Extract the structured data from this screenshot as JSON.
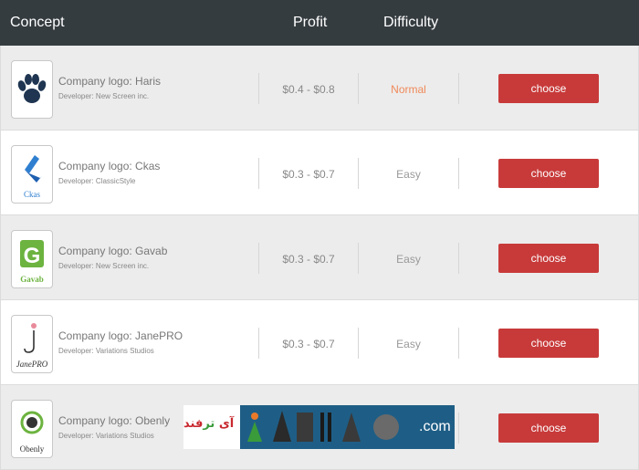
{
  "header": {
    "concept": "Concept",
    "profit": "Profit",
    "difficulty": "Difficulty"
  },
  "rows": [
    {
      "logo_icon": "paw-icon",
      "logo_text": "",
      "title": "Company logo: Haris",
      "developer": "Developer: New Screen inc.",
      "profit": "$0.4 - $0.8",
      "difficulty": "Normal",
      "difficulty_color": "#f08a5a",
      "button": "choose"
    },
    {
      "logo_icon": "chevron-logo-icon",
      "logo_text": "Ckas",
      "title": "Company logo: Ckas",
      "developer": "Developer: ClassicStyle",
      "profit": "$0.3 - $0.7",
      "difficulty": "Easy",
      "difficulty_color": "#999999",
      "button": "choose"
    },
    {
      "logo_icon": "letter-g-icon",
      "logo_text": "Gavab",
      "title": "Company logo: Gavab",
      "developer": "Developer: New Screen inc.",
      "profit": "$0.3 - $0.7",
      "difficulty": "Easy",
      "difficulty_color": "#999999",
      "button": "choose"
    },
    {
      "logo_icon": "letter-j-icon",
      "logo_text": "JanePRO",
      "title": "Company logo: JanePRO",
      "developer": "Developer: Variations Studios",
      "profit": "$0.3 - $0.7",
      "difficulty": "Easy",
      "difficulty_color": "#999999",
      "button": "choose"
    },
    {
      "logo_icon": "ring-logo-icon",
      "logo_text": "Obenly",
      "title": "Company logo: Obenly",
      "developer": "Developer: Variations Studios",
      "profit": "",
      "difficulty": "",
      "difficulty_color": "#999999",
      "button": "choose"
    }
  ],
  "watermark": {
    "persian_1": "آی",
    "persian_2": "تر",
    "persian_3": "فند",
    "domain": ".com"
  },
  "colors": {
    "header_bg": "#353c40",
    "button_bg": "#c83a3a",
    "row_grey": "#ececec"
  }
}
